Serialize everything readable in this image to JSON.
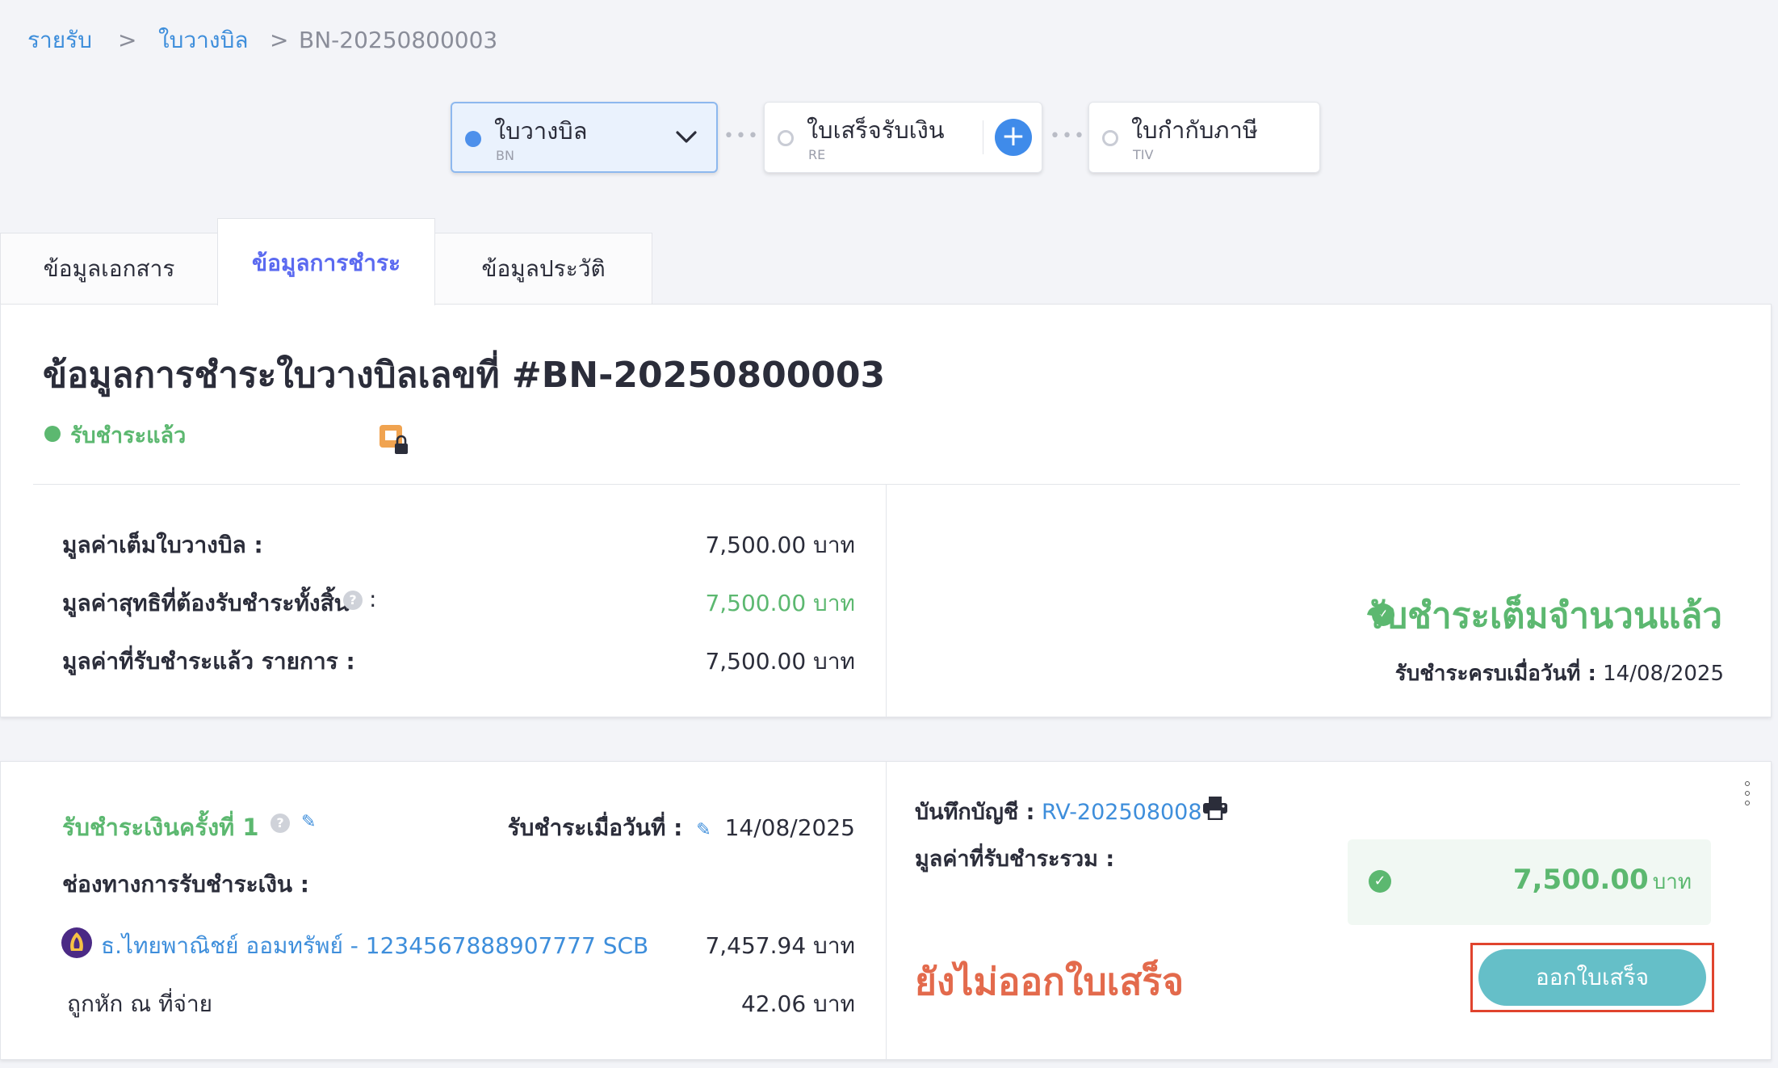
{
  "breadcrumb": {
    "items": [
      "รายรับ",
      "ใบวางบิล",
      "BN-20250800003"
    ],
    "separator": ">"
  },
  "steps": [
    {
      "label": "ใบวางบิล",
      "code": "BN"
    },
    {
      "label": "ใบเสร็จรับเงิน",
      "code": "RE"
    },
    {
      "label": "ใบกำกับภาษี",
      "code": "TIV"
    }
  ],
  "tabs": [
    "ข้อมูลเอกสาร",
    "ข้อมูลการชำระ",
    "ข้อมูลประวัติ"
  ],
  "summary": {
    "title": "ข้อมูลการชำระใบวางบิลเลขที่ #BN-20250800003",
    "status": "รับชำระแล้ว",
    "rows": [
      {
        "label": "มูลค่าเต็มใบวางบิล :",
        "value": "7,500.00 บาท"
      },
      {
        "label": "มูลค่าสุทธิที่ต้องรับชำระทั้งสิ้น",
        "suffix": ":",
        "value": "7,500.00 บาท"
      },
      {
        "label": "มูลค่าที่รับชำระแล้ว รายการ :",
        "value": "7,500.00 บาท"
      }
    ],
    "paid_full": "รับชำระเต็มจำนวนแล้ว",
    "paid_date_label": "รับชำระครบเมื่อวันที่ :",
    "paid_date": "14/08/2025"
  },
  "payment": {
    "title": "รับชำระเงินครั้งที่ 1",
    "date_label": "รับชำระเมื่อวันที่ :",
    "date": "14/08/2025",
    "channel_label": "ช่องทางการรับชำระเงิน :",
    "bank_line": "ธ.ไทยพาณิชย์ ออมทรัพย์ - 1234567888907777 SCB",
    "bank_amount": "7,457.94 บาท",
    "wht_label": "ถูกหัก ณ ที่จ่าย",
    "wht_amount": "42.06 บาท",
    "ledger_label": "บันทึกบัญชี :",
    "ledger_ref": "RV-202508008",
    "total_label": "มูลค่าที่รับชำระรวม :",
    "total_amount": "7,500.00",
    "total_unit": "บาท",
    "receipt_status": "ยังไม่ออกใบเสร็จ",
    "issue_button": "ออกใบเสร็จ"
  },
  "colors": {
    "accent_blue": "#3e8edb",
    "success_green": "#5cb870",
    "warning_orange": "#e36a4c",
    "button_teal": "#65bfc8",
    "highlight_red": "#e0442e"
  }
}
